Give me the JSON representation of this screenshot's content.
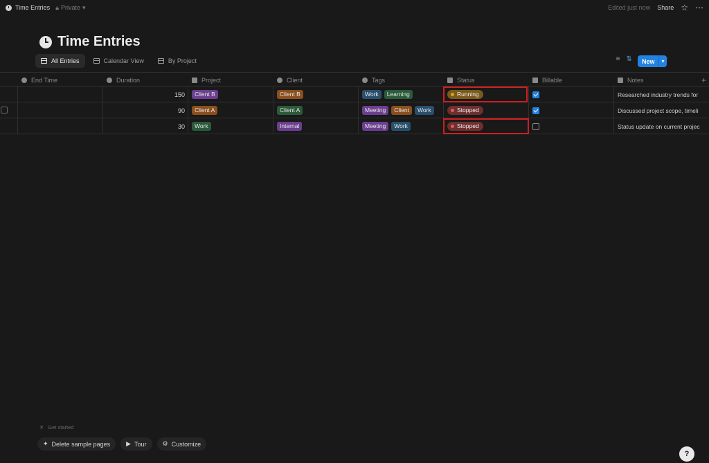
{
  "topbar": {
    "breadcrumb": "Time Entries",
    "privacy": "Private",
    "edited": "Edited just now",
    "share": "Share"
  },
  "page": {
    "title": "Time Entries"
  },
  "views": [
    {
      "label": "All Entries",
      "icon": "table-icon"
    },
    {
      "label": "Calendar View",
      "icon": "calendar-icon"
    },
    {
      "label": "By Project",
      "icon": "board-icon"
    }
  ],
  "toolbar": {
    "new_label": "New"
  },
  "columns": {
    "end_time": "End Time",
    "duration": "Duration",
    "project": "Project",
    "client": "Client",
    "tags": "Tags",
    "status": "Status",
    "billable": "Billable",
    "notes": "Notes"
  },
  "rows": [
    {
      "duration": "150",
      "project": "Client B",
      "client": "Client B",
      "tags": [
        "Work",
        "Learning"
      ],
      "status": "Running",
      "billable": true,
      "notes": "Researched industry trends for"
    },
    {
      "duration": "90",
      "project": "Client A",
      "client": "Client A",
      "tags": [
        "Meeting",
        "Client",
        "Work"
      ],
      "status": "Stopped",
      "billable": true,
      "notes": "Discussed project scope, timeli"
    },
    {
      "duration": "30",
      "project": "Work",
      "client": "Internal",
      "tags": [
        "Meeting",
        "Work"
      ],
      "status": "Stopped",
      "billable": false,
      "notes": "Status update on current projec"
    }
  ],
  "colors": {
    "tag_purple": "#6b3f8f",
    "tag_orange": "#8a4f1c",
    "tag_green": "#2b5a3a",
    "tag_blue": "#28506e",
    "status_running_bg": "#7a5a1a",
    "status_running_dot": "#d9a020",
    "status_stopped_bg": "#6e2f2f",
    "status_stopped_dot": "#e05a5a",
    "accent": "#2383e2",
    "highlight": "#d11f1f"
  },
  "bottom": {
    "get_started": "Get started",
    "buttons": [
      "Delete sample pages",
      "Tour",
      "Customize"
    ],
    "help": "?"
  }
}
